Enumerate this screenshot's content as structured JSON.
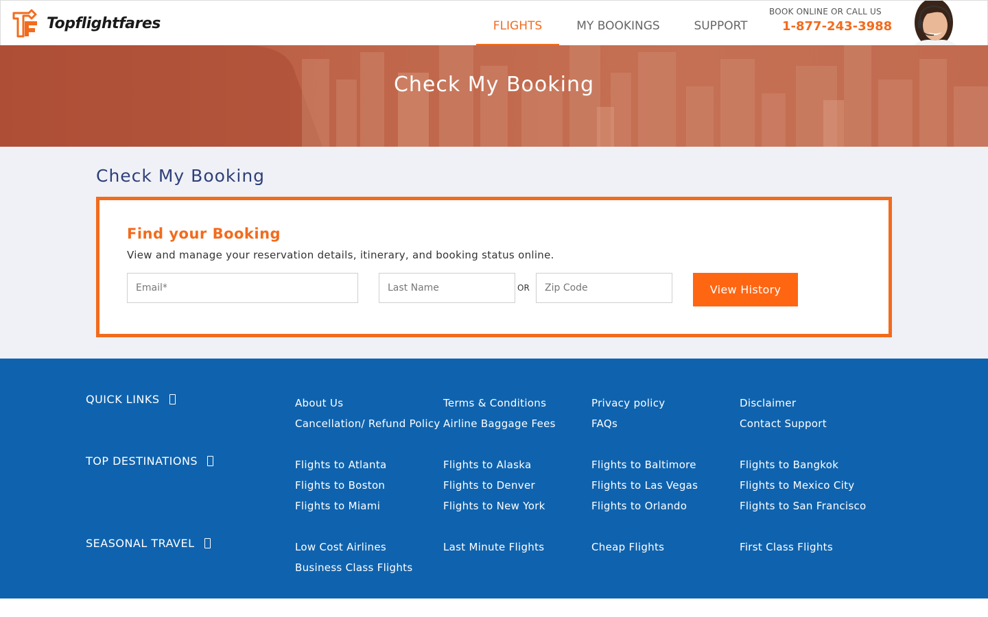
{
  "brand": {
    "name": "Topflightfares",
    "logo_color": "#f26b1d"
  },
  "nav": {
    "items": [
      {
        "label": "FLIGHTS",
        "active": true
      },
      {
        "label": "MY BOOKINGS",
        "active": false
      },
      {
        "label": "SUPPORT",
        "active": false
      }
    ]
  },
  "contact": {
    "label": "BOOK ONLINE OR CALL US",
    "phone": "1-877-243-3988"
  },
  "hero": {
    "title": "Check My Booking"
  },
  "main": {
    "page_title": "Check My Booking",
    "box": {
      "title": "Find your Booking",
      "description": "View and manage your reservation details, itinerary, and booking status online.",
      "email_placeholder": "Email*",
      "lastname_placeholder": "Last Name",
      "or_label": "OR",
      "zip_placeholder": "Zip Code",
      "button_label": "View History"
    }
  },
  "footer": {
    "quick_links": {
      "title": "QUICK LINKS",
      "links": [
        "About Us",
        "Terms & Conditions",
        "Privacy policy",
        "Disclaimer",
        "Cancellation/ Refund Policy",
        "Airline Baggage Fees",
        "FAQs",
        "Contact Support"
      ]
    },
    "top_destinations": {
      "title": "TOP DESTINATIONS",
      "links": [
        "Flights to Atlanta",
        "Flights to Alaska",
        "Flights to Baltimore",
        "Flights to Bangkok",
        "Flights to Boston",
        "Flights to Denver",
        "Flights to Las Vegas",
        "Flights to Mexico City",
        "Flights to Miami",
        "Flights to New York",
        "Flights to Orlando",
        "Flights to San Francisco"
      ]
    },
    "seasonal_travel": {
      "title": "SEASONAL TRAVEL",
      "links": [
        "Low Cost Airlines",
        "Last Minute Flights",
        "Cheap Flights",
        "First Class Flights",
        "Business Class Flights"
      ]
    }
  },
  "colors": {
    "accent": "#f26b1d",
    "button": "#ff6612",
    "footer_bg": "#0f63ae",
    "main_bg": "#f0f1f6",
    "title_blue": "#2e3f7a"
  }
}
